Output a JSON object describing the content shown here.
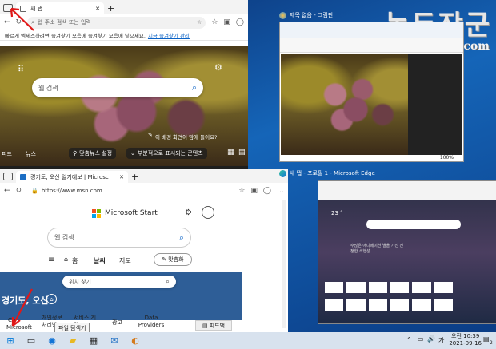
{
  "watermark": {
    "title": "녹두장군",
    "url": "http://mainia.tistory.com"
  },
  "top_window": {
    "tab_title": "새 탭",
    "new_tab": "+",
    "address_placeholder": "웹 주소 검색 또는 입력",
    "fav_bar_text": "빠르게 엑세스하려면 즐겨찾기 모음에 즐겨찾기 모음에 넣으세요.",
    "fav_link": "지금 즐겨찾기 관리",
    "search_placeholder": "웹 검색",
    "like_question": "이 배경 화면이 맘에 들어요?",
    "bottom_left": "피드",
    "bottom_news": "뉴스",
    "custom_settings": "맞춤뉴스 설정",
    "partial_content": "부분적으로 표시되는 콘텐츠"
  },
  "bottom_window": {
    "tab_title": "경기도, 오산 일기예보 | Microsc",
    "new_tab": "+",
    "address": "https://www.msn.com...",
    "brand": "Microsoft Start",
    "search_placeholder": "웹 검색",
    "nav_home": "홈",
    "nav_weather": "날씨",
    "nav_map": "지도",
    "personalize": "맞춤화",
    "location_search": "위치 찾기",
    "location_title": "경기도, 오산",
    "footer_items": [
      "Microsoft",
      "개인정보 처리방",
      "서비스 계약",
      "광고",
      "Data Providers"
    ],
    "footer_partial": "Ca",
    "feedback": "피드백",
    "tooltip": "파일 탐색기"
  },
  "right_thumbs": {
    "paint_title": "제목 없음 - 그림판",
    "edge_title": "새 탭 - 프로필 1 - Microsoft Edge",
    "edge_temp": "23 °",
    "edge_caption": "수많은 애니메이션 별을 가진 진정한 소행성",
    "paint_statusbar": "100%"
  },
  "taskbar": {
    "time": "오전 10:39",
    "date": "2021-09-16",
    "lang": "가",
    "notify_count": "2"
  },
  "colors": {
    "accent": "#0a62c5",
    "red_arrow": "#e01818",
    "msn_blue": "#2e5e97"
  }
}
